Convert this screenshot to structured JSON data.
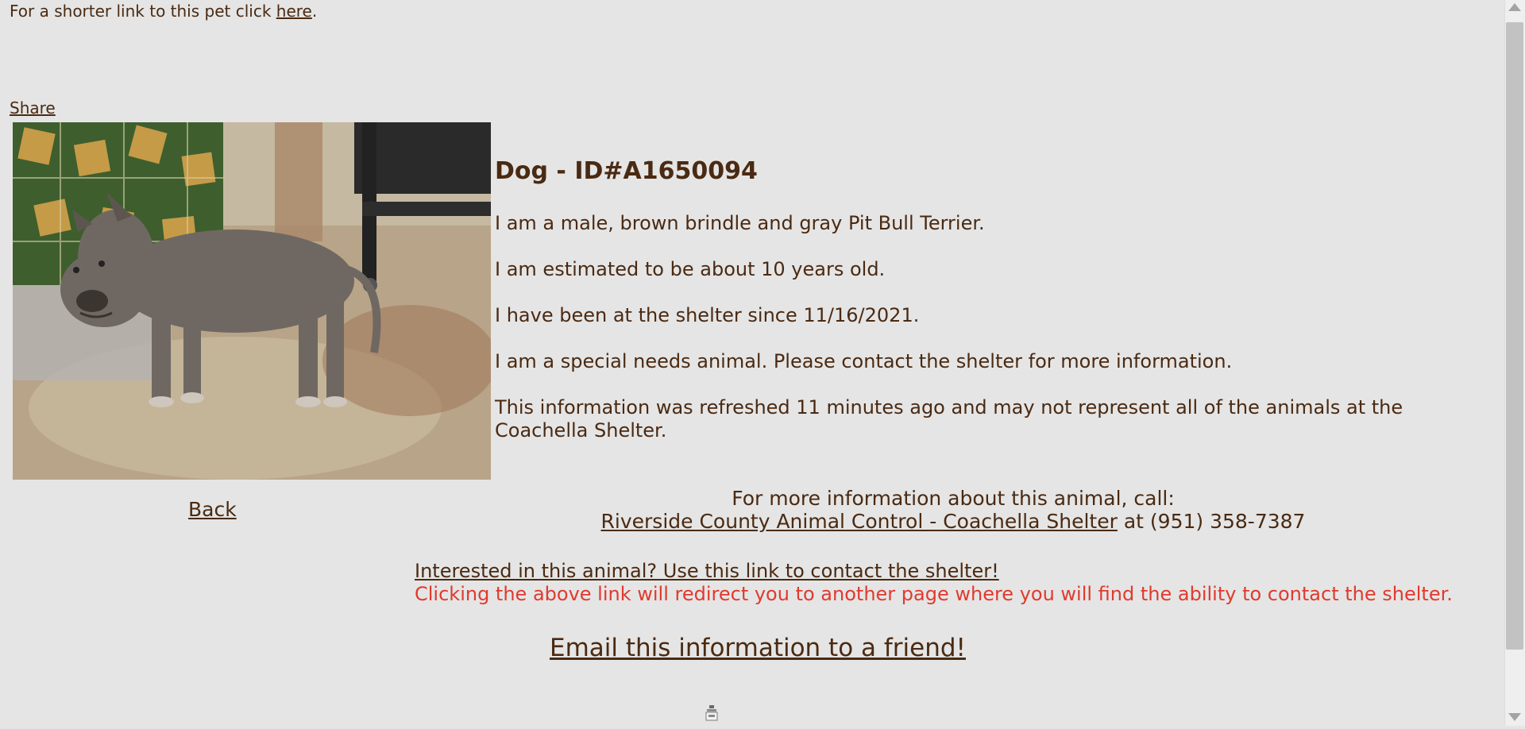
{
  "header": {
    "short_link_prefix": "For a shorter link to this pet click ",
    "short_link_label": "here",
    "short_link_suffix": ".",
    "share_label": "Share"
  },
  "pet": {
    "title": "Dog - ID#A1650094",
    "facts": [
      "I am a male, brown brindle and gray Pit Bull Terrier.",
      "I am estimated to be about 10 years old.",
      "I have been at the shelter since 11/16/2021.",
      "I am a special needs animal. Please contact the shelter for more information.",
      "This information was refreshed 11 minutes ago and may not represent all of the animals at the Coachella Shelter."
    ]
  },
  "nav": {
    "back_label": "Back"
  },
  "contact": {
    "call_intro": "For more information about this animal, call:",
    "shelter_name": "Riverside County Animal Control - Coachella Shelter",
    "phone_text": " at (951) 358-7387",
    "interest_link": "Interested in this animal? Use this link to contact the shelter!",
    "redirect_note": "Clicking the above link will redirect you to another page where you will find the ability to contact the shelter.",
    "email_link": "Email this information to a friend!"
  },
  "colors": {
    "background": "#e5e5e5",
    "text": "#4a2a12",
    "warning": "#e03a2e"
  }
}
